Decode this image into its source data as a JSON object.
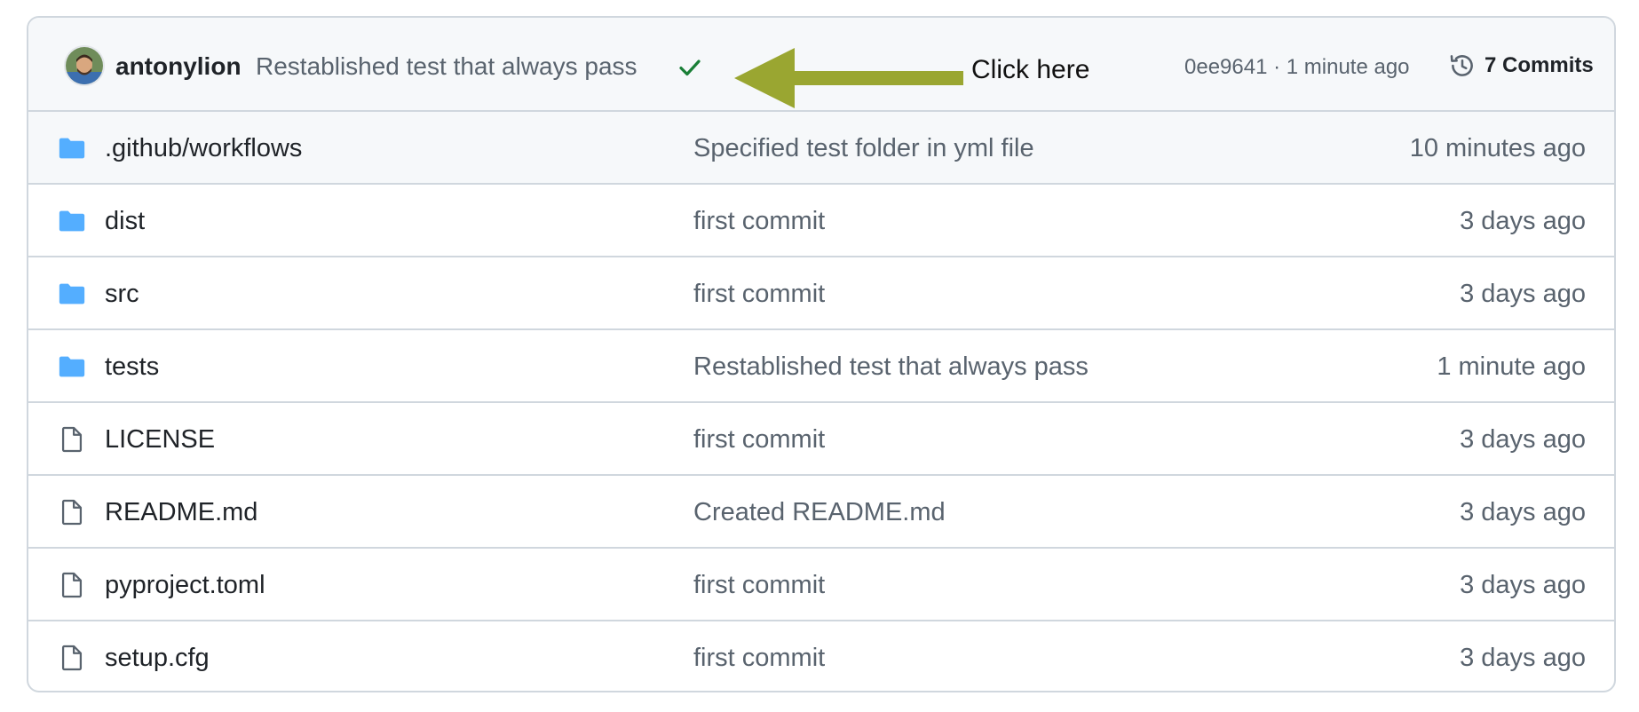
{
  "latest_commit": {
    "author": "antonylion",
    "message": "Restablished test that always pass",
    "status": "success",
    "sha_time": "0ee9641 · 1 minute ago",
    "commits_label": "7 Commits"
  },
  "annotation": {
    "text": "Click here",
    "arrow_color": "#9aa631"
  },
  "colors": {
    "folder": "#54aeff",
    "check": "#1a7f37",
    "file_icon": "#59636e"
  },
  "files": [
    {
      "name": ".github/workflows",
      "type": "folder",
      "message": "Specified test folder in yml file",
      "time": "10 minutes ago"
    },
    {
      "name": "dist",
      "type": "folder",
      "message": "first commit",
      "time": "3 days ago"
    },
    {
      "name": "src",
      "type": "folder",
      "message": "first commit",
      "time": "3 days ago"
    },
    {
      "name": "tests",
      "type": "folder",
      "message": "Restablished test that always pass",
      "time": "1 minute ago"
    },
    {
      "name": "LICENSE",
      "type": "file",
      "message": "first commit",
      "time": "3 days ago"
    },
    {
      "name": "README.md",
      "type": "file",
      "message": "Created README.md",
      "time": "3 days ago"
    },
    {
      "name": "pyproject.toml",
      "type": "file",
      "message": "first commit",
      "time": "3 days ago"
    },
    {
      "name": "setup.cfg",
      "type": "file",
      "message": "first commit",
      "time": "3 days ago"
    }
  ]
}
